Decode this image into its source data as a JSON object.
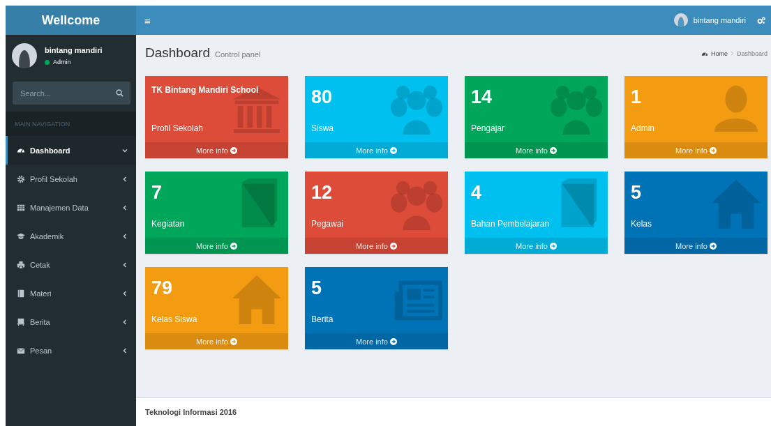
{
  "header": {
    "brand": "Wellcome",
    "menu_toggle": "≡",
    "user_name": "bintang mandiri"
  },
  "sidebar": {
    "user": {
      "name": "bintang mandiri",
      "status": "Admin"
    },
    "search": {
      "placeholder": "Search..."
    },
    "nav_header": "MAIN NAVIGATION",
    "items": [
      {
        "label": "Dashboard",
        "selected": true,
        "expanded": true
      },
      {
        "label": "Profil Sekolah",
        "selected": false,
        "expanded": false
      },
      {
        "label": "Manajemen Data",
        "selected": false,
        "expanded": false
      },
      {
        "label": "Akademik",
        "selected": false,
        "expanded": false
      },
      {
        "label": "Cetak",
        "selected": false,
        "expanded": false
      },
      {
        "label": "Materi",
        "selected": false,
        "expanded": false
      },
      {
        "label": "Berita",
        "selected": false,
        "expanded": false
      },
      {
        "label": "Pesan",
        "selected": false,
        "expanded": false
      }
    ]
  },
  "content": {
    "title": "Dashboard",
    "subtitle": "Control panel",
    "breadcrumb": [
      "Home",
      "Dashboard"
    ]
  },
  "cards": [
    {
      "kind": "title",
      "title": "TK Bintang Mandiri School",
      "label": "Profil Sekolah",
      "link": "More info",
      "color": "#dd4b39"
    },
    {
      "kind": "value",
      "value": "80",
      "label": "Siswa",
      "link": "More info",
      "color": "#00c0ef"
    },
    {
      "kind": "value",
      "value": "14",
      "label": "Pengajar",
      "link": "More info",
      "color": "#00a65a"
    },
    {
      "kind": "value",
      "value": "1",
      "label": "Admin",
      "link": "More info",
      "color": "#f39c12"
    },
    {
      "kind": "value",
      "value": "7",
      "label": "Kegiatan",
      "link": "More info",
      "color": "#00a65a"
    },
    {
      "kind": "value",
      "value": "12",
      "label": "Pegawai",
      "link": "More info",
      "color": "#dd4b39"
    },
    {
      "kind": "value",
      "value": "4",
      "label": "Bahan Pembelajaran",
      "link": "More info",
      "color": "#00c0ef"
    },
    {
      "kind": "value",
      "value": "5",
      "label": "Kelas",
      "link": "More info",
      "color": "#0073b7"
    },
    {
      "kind": "value",
      "value": "79",
      "label": "Kelas Siswa",
      "link": "More info",
      "color": "#f39c12"
    },
    {
      "kind": "value",
      "value": "5",
      "label": "Berita",
      "link": "More info",
      "color": "#0073b7"
    }
  ],
  "footer": "Teknologi Informasi 2016"
}
